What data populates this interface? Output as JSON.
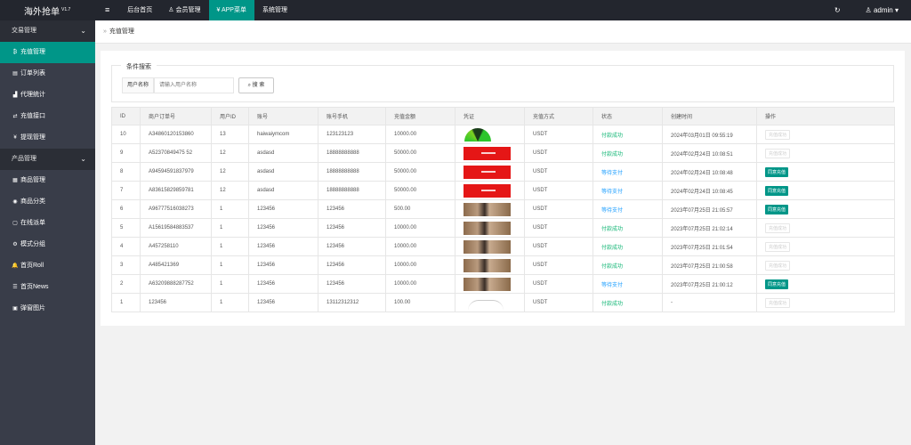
{
  "app": {
    "title": "海外抢单",
    "version": "V1.7"
  },
  "topnav": {
    "menu_icon": "≡",
    "items": [
      {
        "label": "后台首页",
        "icon": "home-icon"
      },
      {
        "label": "会员管理",
        "icon": "user-icon"
      },
      {
        "label": "APP菜单",
        "icon": "yen-icon"
      },
      {
        "label": "系统管理",
        "icon": ""
      }
    ],
    "refresh_icon": "↻",
    "user": "admin"
  },
  "sidebar": {
    "groups": [
      {
        "label": "交易管理",
        "items": [
          {
            "label": "充值管理",
            "icon": "₿"
          },
          {
            "label": "订单列表",
            "icon": "▤"
          },
          {
            "label": "代理统计",
            "icon": "▟"
          },
          {
            "label": "充值接口",
            "icon": "⇄"
          },
          {
            "label": "提现管理",
            "icon": "¥"
          }
        ]
      },
      {
        "label": "产品管理",
        "items": [
          {
            "label": "商品管理",
            "icon": "▦"
          },
          {
            "label": "商品分类",
            "icon": "◉"
          },
          {
            "label": "在线派单",
            "icon": "▢"
          },
          {
            "label": "模式分组",
            "icon": "⚙"
          },
          {
            "label": "首页Roll",
            "icon": "🔔"
          },
          {
            "label": "首页News",
            "icon": "☰"
          },
          {
            "label": "弹窗图片",
            "icon": "▣"
          }
        ]
      }
    ]
  },
  "breadcrumb": {
    "label": "充值管理"
  },
  "filter": {
    "legend": "条件搜索",
    "field_label": "用户名称",
    "placeholder": "请输入用户名称",
    "search_label": "搜 索"
  },
  "table": {
    "headers": [
      "ID",
      "商户订单号",
      "用户ID",
      "账号",
      "账号手机",
      "充值金额",
      "凭证",
      "充值方式",
      "状态",
      "创建时间",
      "操作"
    ],
    "rows": [
      {
        "id": "10",
        "order": "A34860120153860",
        "uid": "13",
        "account": "haiwaiymcom",
        "phone": "123123123",
        "amount": "10000.00",
        "proof": "gauge",
        "method": "USDT",
        "status": "付款成功",
        "status_type": "ok",
        "created": "2024年03月01日 09:55:19",
        "action": "充值成功",
        "action_type": "off"
      },
      {
        "id": "9",
        "order": "A52370849475 52",
        "uid": "12",
        "account": "asdasd",
        "phone": "18888888888",
        "amount": "50000.00",
        "proof": "red",
        "method": "USDT",
        "status": "付款成功",
        "status_type": "ok",
        "created": "2024年02月24日 10:08:51",
        "action": "充值成功",
        "action_type": "off"
      },
      {
        "id": "8",
        "order": "A94594591837979",
        "uid": "12",
        "account": "asdasd",
        "phone": "18888888888",
        "amount": "50000.00",
        "proof": "red",
        "method": "USDT",
        "status": "等待支付",
        "status_type": "wait",
        "created": "2024年02月24日 10:08:48",
        "action": "同意充值",
        "action_type": "on"
      },
      {
        "id": "7",
        "order": "A83615829859781",
        "uid": "12",
        "account": "asdasd",
        "phone": "18888888888",
        "amount": "50000.00",
        "proof": "red",
        "method": "USDT",
        "status": "等待支付",
        "status_type": "wait",
        "created": "2024年02月24日 10:08:45",
        "action": "同意充值",
        "action_type": "on"
      },
      {
        "id": "6",
        "order": "A96777516038273",
        "uid": "1",
        "account": "123456",
        "phone": "123456",
        "amount": "500.00",
        "proof": "photo",
        "method": "USDT",
        "status": "等待支付",
        "status_type": "wait",
        "created": "2023年07月25日 21:05:57",
        "action": "同意充值",
        "action_type": "on"
      },
      {
        "id": "5",
        "order": "A15619584883537",
        "uid": "1",
        "account": "123456",
        "phone": "123456",
        "amount": "10000.00",
        "proof": "photo",
        "method": "USDT",
        "status": "付款成功",
        "status_type": "ok",
        "created": "2023年07月25日 21:02:14",
        "action": "充值成功",
        "action_type": "off"
      },
      {
        "id": "4",
        "order": "A457258110",
        "uid": "1",
        "account": "123456",
        "phone": "123456",
        "amount": "10000.00",
        "proof": "photo",
        "method": "USDT",
        "status": "付款成功",
        "status_type": "ok",
        "created": "2023年07月25日 21:01:54",
        "action": "充值成功",
        "action_type": "off"
      },
      {
        "id": "3",
        "order": "A485421369",
        "uid": "1",
        "account": "123456",
        "phone": "123456",
        "amount": "10000.00",
        "proof": "photo",
        "method": "USDT",
        "status": "付款成功",
        "status_type": "ok",
        "created": "2023年07月25日 21:00:58",
        "action": "充值成功",
        "action_type": "off"
      },
      {
        "id": "2",
        "order": "A63209888287752",
        "uid": "1",
        "account": "123456",
        "phone": "123456",
        "amount": "10000.00",
        "proof": "photo",
        "method": "USDT",
        "status": "等待支付",
        "status_type": "wait",
        "created": "2023年07月25日 21:00:12",
        "action": "同意充值",
        "action_type": "on"
      },
      {
        "id": "1",
        "order": "123456",
        "uid": "1",
        "account": "123456",
        "phone": "13112312312",
        "amount": "100.00",
        "proof": "ring",
        "method": "USDT",
        "status": "付款成功",
        "status_type": "ok",
        "created": "-",
        "action": "充值成功",
        "action_type": "off"
      }
    ]
  },
  "colors": {
    "accent": "#009688",
    "topbar": "#23262e",
    "sidebar": "#393d49",
    "ok": "#16b777",
    "wait": "#1e9fff"
  }
}
